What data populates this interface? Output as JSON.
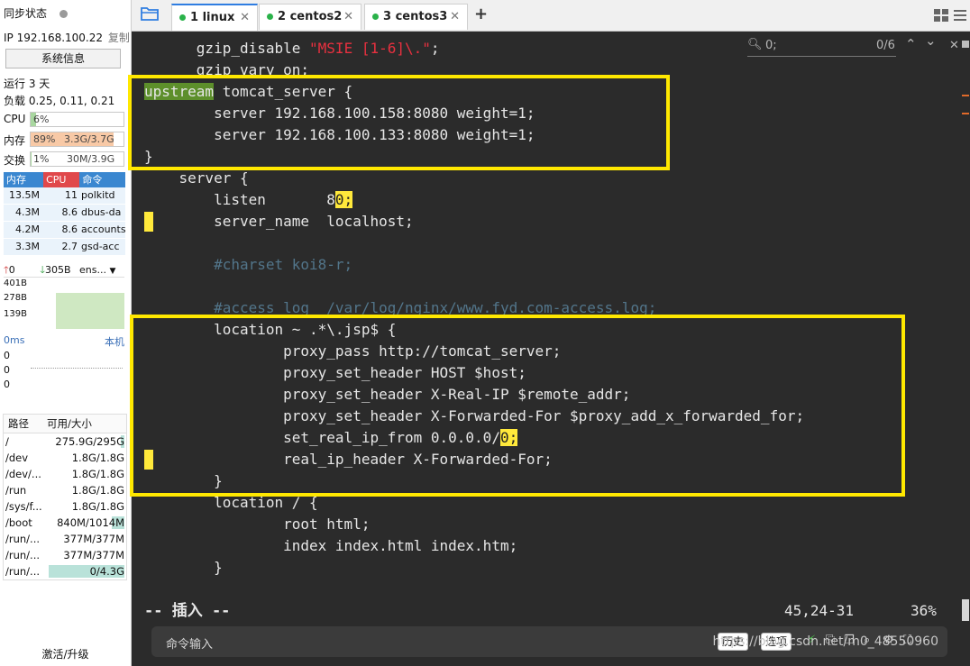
{
  "sidebar": {
    "sync_label": "同步状态",
    "ip": "IP 192.168.100.22",
    "copy_label": "复制",
    "sysinfo_button": "系统信息",
    "uptime": "运行 3 天",
    "load": "负载 0.25, 0.11, 0.21",
    "cpu": {
      "label": "CPU",
      "value": "6%",
      "fraction": 0.06
    },
    "mem": {
      "label": "内存",
      "value": "89%",
      "detail": "3.3G/3.7G",
      "fraction": 0.89
    },
    "swap": {
      "label": "交换",
      "value": "1%",
      "detail": "30M/3.9G",
      "fraction": 0.01
    },
    "proc_headers": [
      "内存",
      "CPU",
      "命令"
    ],
    "processes": [
      {
        "mem": "13.5M",
        "cpu": "11",
        "cmd": "polkitd"
      },
      {
        "mem": "4.3M",
        "cpu": "8.6",
        "cmd": "dbus-da"
      },
      {
        "mem": "4.2M",
        "cpu": "8.6",
        "cmd": "accounts"
      },
      {
        "mem": "3.3M",
        "cpu": "2.7",
        "cmd": "gsd-acc"
      }
    ],
    "net": {
      "up": "0",
      "down": "305B",
      "iface": "ens...",
      "scale": [
        "401B",
        "278B",
        "139B"
      ]
    },
    "ping": {
      "latency": "0ms",
      "host": "本机",
      "values": [
        "0",
        "0",
        "0"
      ]
    },
    "disk_headers": [
      "路径",
      "可用/大小"
    ],
    "disks": [
      {
        "path": "/",
        "value": "275.9G/295G",
        "used": 0.06
      },
      {
        "path": "/dev",
        "value": "1.8G/1.8G",
        "used": 0.0
      },
      {
        "path": "/dev/...",
        "value": "1.8G/1.8G",
        "used": 0.0
      },
      {
        "path": "/run",
        "value": "1.8G/1.8G",
        "used": 0.0
      },
      {
        "path": "/sys/f...",
        "value": "1.8G/1.8G",
        "used": 0.0
      },
      {
        "path": "/boot",
        "value": "840M/1014M",
        "used": 0.17
      },
      {
        "path": "/run/...",
        "value": "377M/377M",
        "used": 0.0
      },
      {
        "path": "/run/...",
        "value": "377M/377M",
        "used": 0.0
      },
      {
        "path": "/run/...",
        "value": "0/4.3G",
        "used": 1.0
      }
    ],
    "activate_label": "激活/升级"
  },
  "tabs": [
    {
      "label": "1 linux",
      "active": true
    },
    {
      "label": "2 centos2",
      "active": false
    },
    {
      "label": "3 centos3",
      "active": false
    }
  ],
  "find": {
    "query": "0;",
    "count": "0/6"
  },
  "editor": {
    "mode": "-- 插入 --",
    "position": "45,24-31",
    "percent": "36%"
  },
  "cmdbar": {
    "placeholder": "命令输入",
    "history": "历史",
    "options": "选项",
    "watermark": "https://blog.csdn.net/m0_48550960"
  },
  "colors": {
    "highlight_box": "#ffe800",
    "keyword_bg": "#5d8f2b",
    "comment": "#52758a",
    "string": "#e8303f",
    "active_tab": "#2f7de1"
  }
}
